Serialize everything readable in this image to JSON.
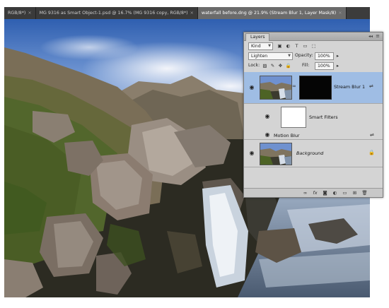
{
  "document_tabs": [
    {
      "label": "RGB/8*)",
      "active": false
    },
    {
      "label": "MG 9316 as Smart Object-1.psd @ 16.7% (MG 9316 copy, RGB/8*)",
      "active": false
    },
    {
      "label": "waterfall before.dng @ 21.9% (Stream Blur 1, Layer Mask/8)",
      "active": true
    }
  ],
  "tab_close_glyph": "×",
  "layers_panel": {
    "tab_label": "Layers",
    "collapse_glyph": "◂◂",
    "menu_glyph": "≡",
    "filter_kind": "Kind",
    "blend_mode": "Lighten",
    "opacity_label": "Opacity:",
    "opacity_value": "100%",
    "lock_label": "Lock:",
    "fill_label": "Fill:",
    "fill_value": "100%",
    "filter_icons": [
      "image-filter-icon",
      "adjustment-filter-icon",
      "type-filter-icon",
      "shape-filter-icon",
      "smart-object-filter-icon"
    ],
    "filter_glyphs": [
      "▣",
      "◐",
      "T",
      "▭",
      "⬚"
    ],
    "lock_icons": [
      "lock-transparent-icon",
      "lock-pixels-icon",
      "lock-position-icon",
      "lock-all-icon"
    ],
    "lock_glyphs": [
      "▨",
      "✎",
      "✥",
      "🔒"
    ],
    "layers": [
      {
        "name": "Stream Blur 1",
        "selected": true,
        "type": "smart-object"
      },
      {
        "name": "Smart Filters",
        "type": "smart-filters"
      },
      {
        "name": "Motion Blur",
        "type": "filter-effect"
      },
      {
        "name": "Background",
        "type": "background",
        "italic": true
      }
    ],
    "eye_glyph": "◉",
    "lock_glyph": "🔒",
    "link_glyph": "∞",
    "blend_options_glyph": "⇌",
    "bottom_icons": [
      "link-layers-icon",
      "fx-icon",
      "layer-mask-icon",
      "adjustment-layer-icon",
      "new-group-icon",
      "new-layer-icon",
      "delete-layer-icon"
    ],
    "bottom_glyphs": [
      "∞",
      "fx",
      "◙",
      "◐",
      "▭",
      "⊞",
      "🗑"
    ]
  },
  "colors": {
    "panel_bg": "#d4d4d4",
    "selected_layer": "#9fbde4",
    "tab_bar": "#3c3c3c"
  }
}
